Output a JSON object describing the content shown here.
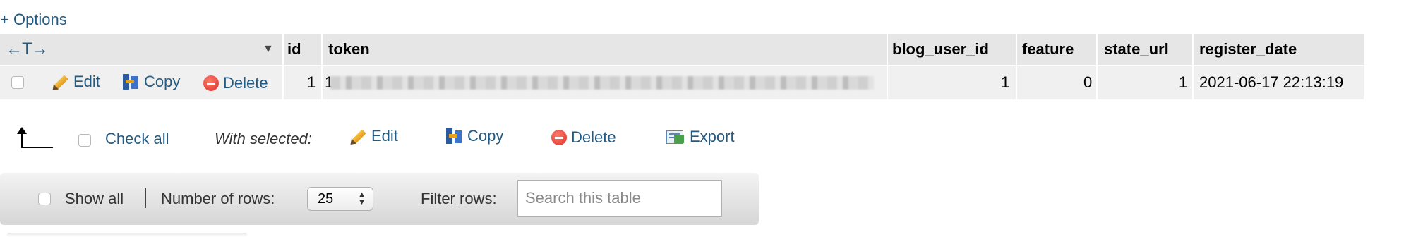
{
  "options_link": "+ Options",
  "columns": {
    "id": "id",
    "token": "token",
    "blog_user_id": "blog_user_id",
    "feature": "feature",
    "state_url": "state_url",
    "register_date": "register_date"
  },
  "row_actions": {
    "edit": "Edit",
    "copy": "Copy",
    "delete": "Delete"
  },
  "rows": [
    {
      "id": "1",
      "token_prefix": "1",
      "blog_user_id": "1",
      "feature": "0",
      "state_url": "1",
      "register_date": "2021-06-17 22:13:19"
    }
  ],
  "bulk": {
    "check_all": "Check all",
    "with_selected": "With selected:",
    "edit": "Edit",
    "copy": "Copy",
    "delete": "Delete",
    "export": "Export"
  },
  "navigation": {
    "show_all": "Show all",
    "divider": "|",
    "number_of_rows_label": "Number of rows:",
    "number_of_rows_value": "25",
    "filter_rows_label": "Filter rows:",
    "search_placeholder": "Search this table"
  },
  "icons": {
    "resize_arrows": "←T→",
    "sort_caret": "▼",
    "select_arrows": "▲▼"
  }
}
